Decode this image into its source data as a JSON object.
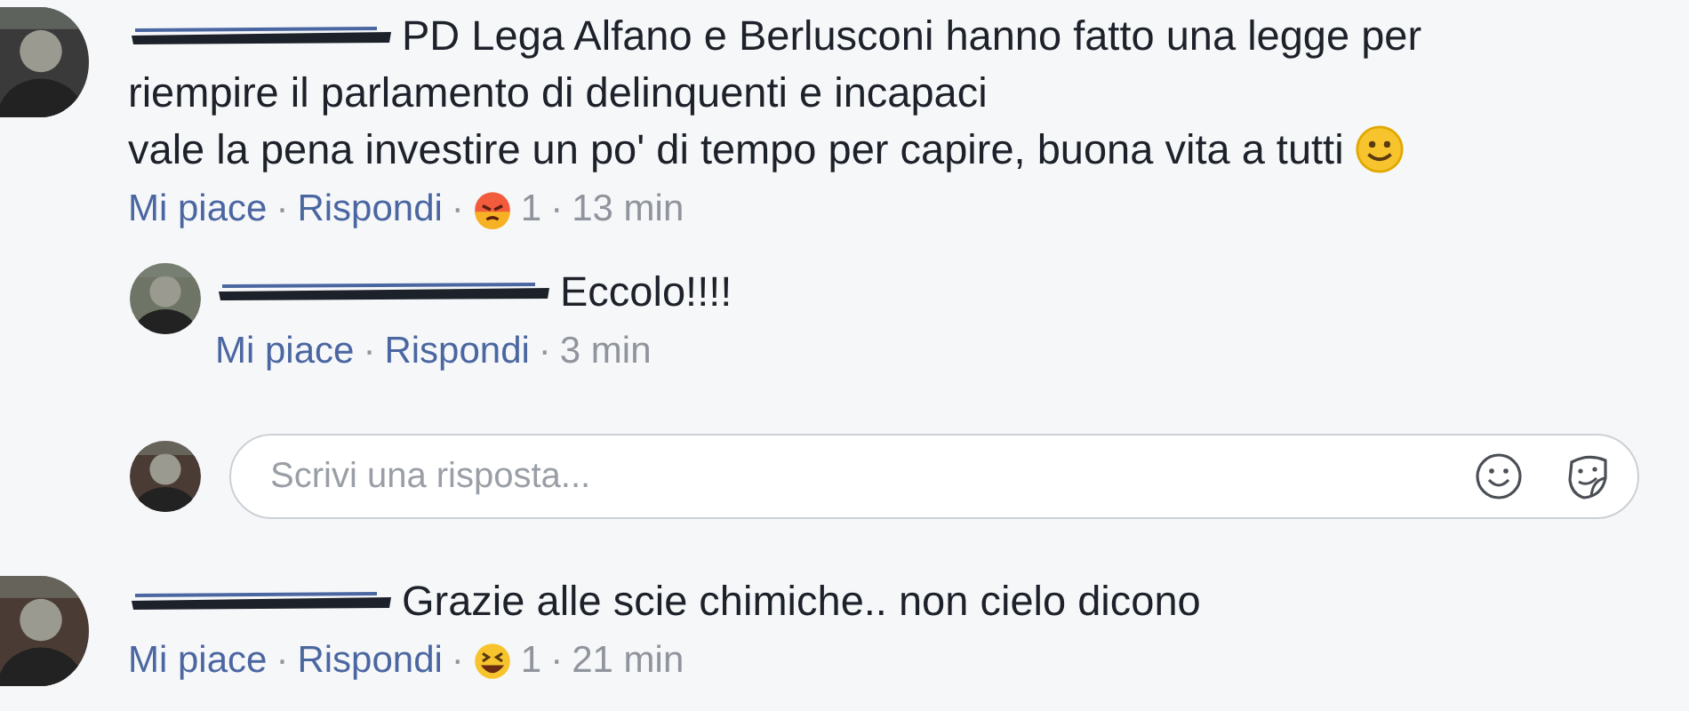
{
  "separator": "·",
  "comments": [
    {
      "redacted_name": true,
      "body_lines": [
        "PD Lega Alfano e Berlusconi hanno fatto una legge per",
        "riempire il parlamento di delinquenti e incapaci",
        "vale la pena investire un po' di tempo per capire, buona vita a tutti"
      ],
      "trailing_emoji": {
        "kind": "smile"
      },
      "like": "Mi piace",
      "reply": "Rispondi",
      "reaction": {
        "kind": "angry",
        "count": "1"
      },
      "time": "13 min",
      "replies": [
        {
          "redacted_name": true,
          "body_lines": [
            "Eccolo!!!!"
          ],
          "like": "Mi piace",
          "reply": "Rispondi",
          "time": "3 min"
        }
      ],
      "reply_box": {
        "placeholder": "Scrivi una risposta..."
      }
    },
    {
      "redacted_name": true,
      "body_lines": [
        "Grazie alle scie chimiche.. non cielo dicono"
      ],
      "like": "Mi piace",
      "reply": "Rispondi",
      "reaction": {
        "kind": "haha",
        "count": "1"
      },
      "time": "21 min"
    }
  ]
}
